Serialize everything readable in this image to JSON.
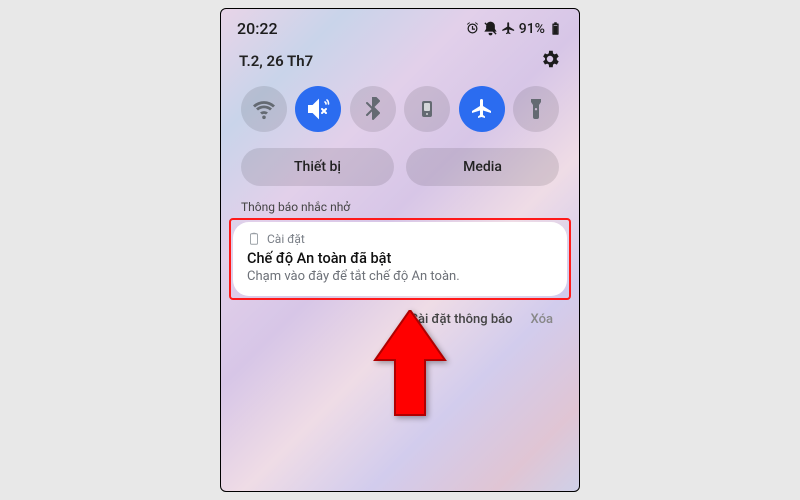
{
  "status": {
    "time": "20:22",
    "battery_pct": "91%"
  },
  "date": "T.2, 26 Th7",
  "pills": {
    "devices": "Thiết bị",
    "media": "Media"
  },
  "section_label": "Thông báo nhắc nhở",
  "notif": {
    "app": "Cài đặt",
    "title": "Chế độ An toàn đã bật",
    "body": "Chạm vào đây để tắt chế độ An toàn."
  },
  "shade_actions": {
    "settings": "Cài đặt thông báo",
    "clear": "Xóa"
  },
  "toggles": {
    "wifi": false,
    "sound": true,
    "bluetooth": false,
    "rotation": false,
    "airplane": true,
    "flashlight": false
  }
}
